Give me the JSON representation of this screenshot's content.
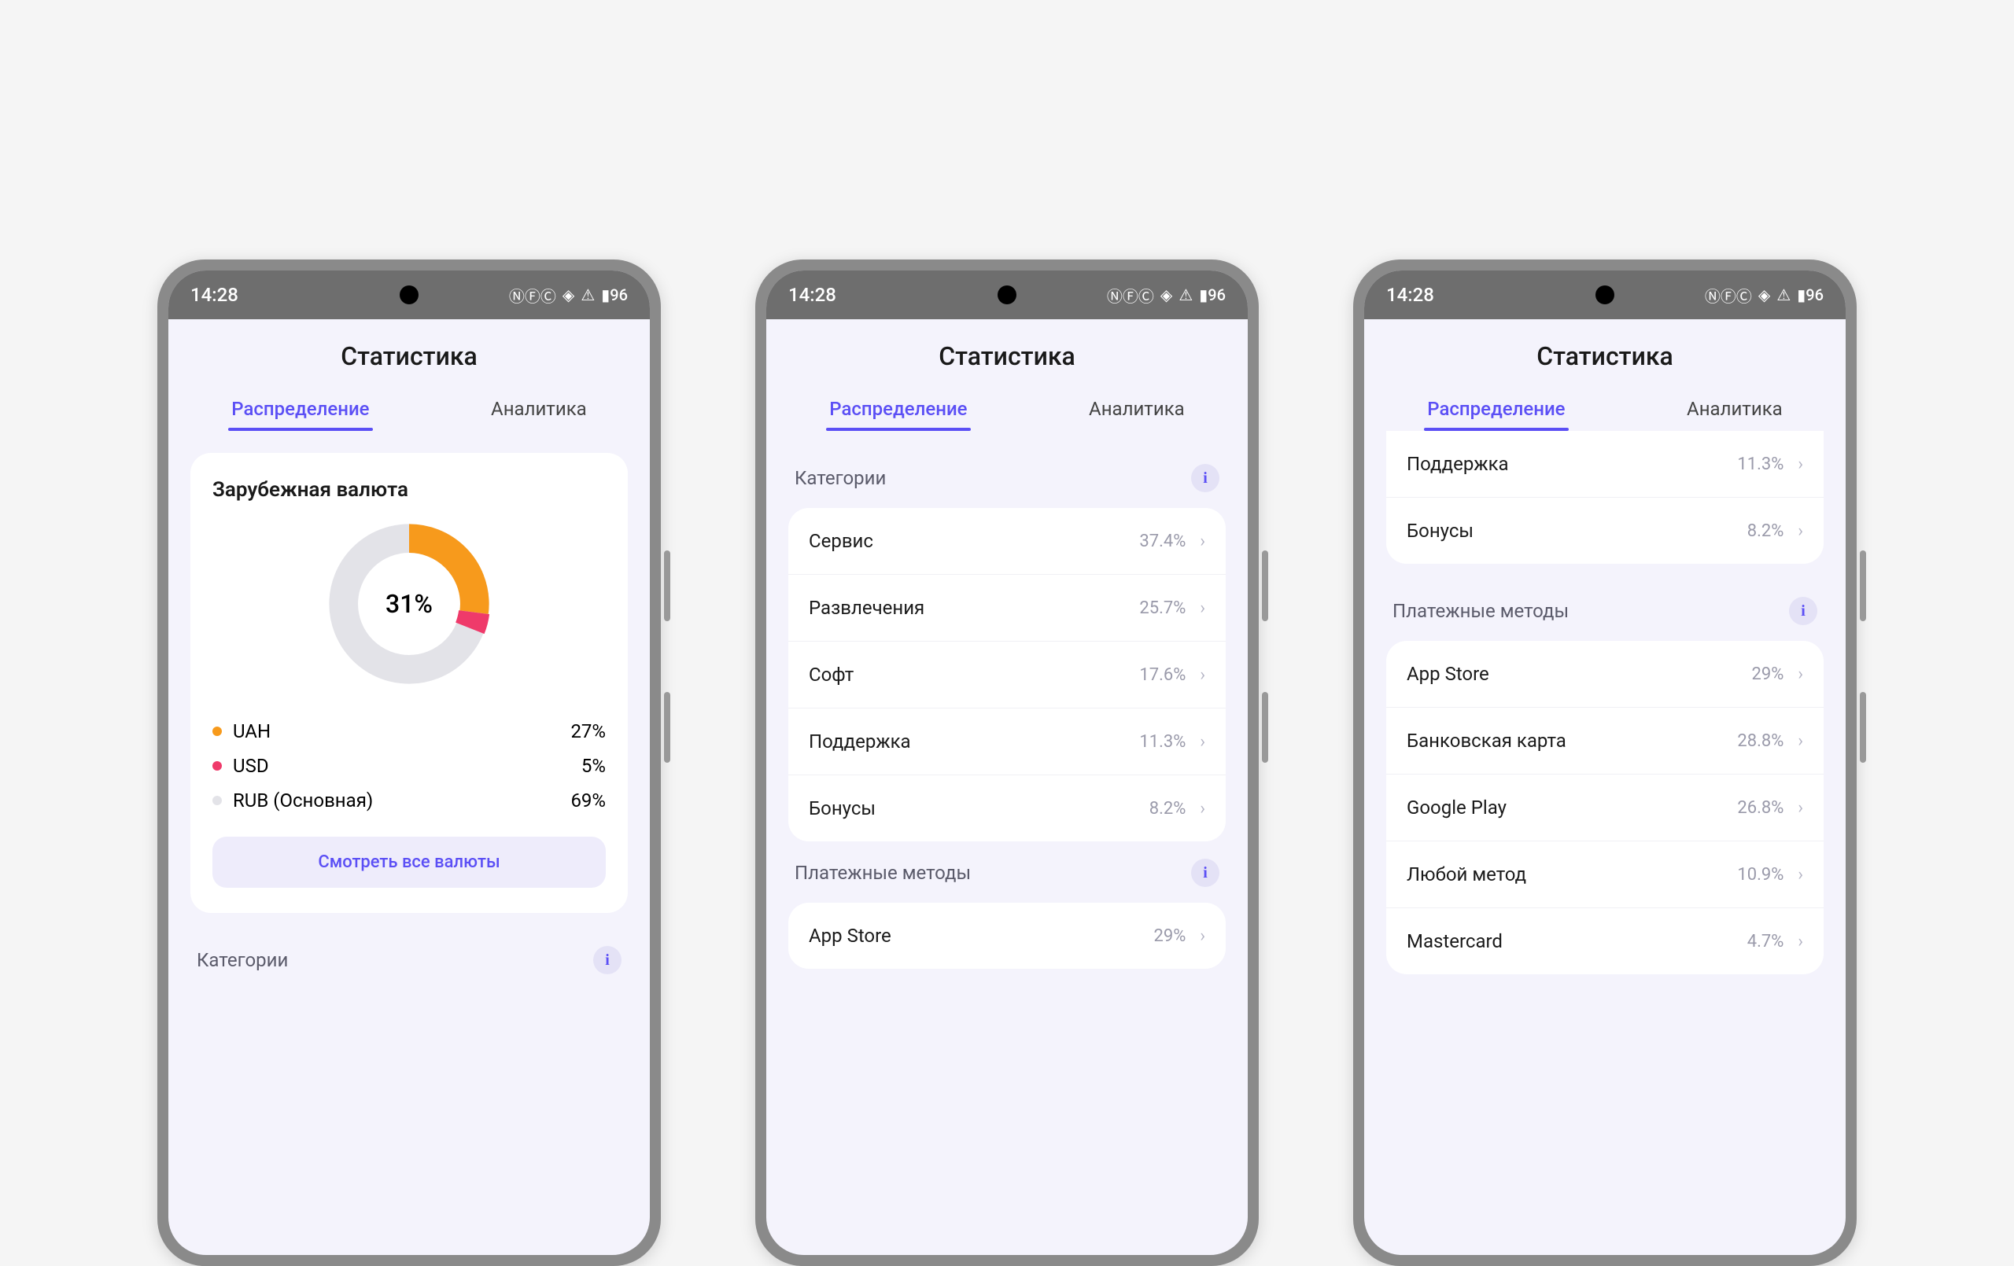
{
  "status": {
    "time": "14:28",
    "battery": "96"
  },
  "header": "Статистика",
  "tabs": {
    "distribution": "Распределение",
    "analytics": "Аналитика"
  },
  "chart_data": {
    "type": "pie",
    "title": "Зарубежная валюта",
    "center_label": "31%",
    "series": [
      {
        "name": "UAH",
        "value": 27,
        "color": "#f79a1c"
      },
      {
        "name": "USD",
        "value": 5,
        "color": "#ef3a6a"
      },
      {
        "name": "RUB (Основная)",
        "value": 69,
        "color": "#e3e3e8"
      }
    ]
  },
  "p1": {
    "currency_title": "Зарубежная валюта",
    "center": "31%",
    "legend": [
      {
        "dot": "#f79a1c",
        "label": "UAH",
        "value": "27%"
      },
      {
        "dot": "#ef3a6a",
        "label": "USD",
        "value": "5%"
      },
      {
        "dot": "#e3e3e8",
        "label": "RUB (Основная)",
        "value": "69%"
      }
    ],
    "cta": "Смотреть все валюты",
    "categories_title": "Категории"
  },
  "p2": {
    "categories_title": "Категории",
    "categories": [
      {
        "label": "Сервис",
        "value": "37.4%"
      },
      {
        "label": "Развлечения",
        "value": "25.7%"
      },
      {
        "label": "Софт",
        "value": "17.6%"
      },
      {
        "label": "Поддержка",
        "value": "11.3%"
      },
      {
        "label": "Бонусы",
        "value": "8.2%"
      }
    ],
    "payment_title": "Платежные методы",
    "payment_peek": {
      "label": "App Store",
      "value": "29%"
    }
  },
  "p3": {
    "cat_tail": [
      {
        "label": "Поддержка",
        "value": "11.3%"
      },
      {
        "label": "Бонусы",
        "value": "8.2%"
      }
    ],
    "payment_title": "Платежные методы",
    "payments": [
      {
        "label": "App Store",
        "value": "29%"
      },
      {
        "label": "Банковская карта",
        "value": "28.8%"
      },
      {
        "label": "Google Play",
        "value": "26.8%"
      },
      {
        "label": "Любой метод",
        "value": "10.9%"
      },
      {
        "label": "Mastercard",
        "value": "4.7%"
      }
    ]
  }
}
